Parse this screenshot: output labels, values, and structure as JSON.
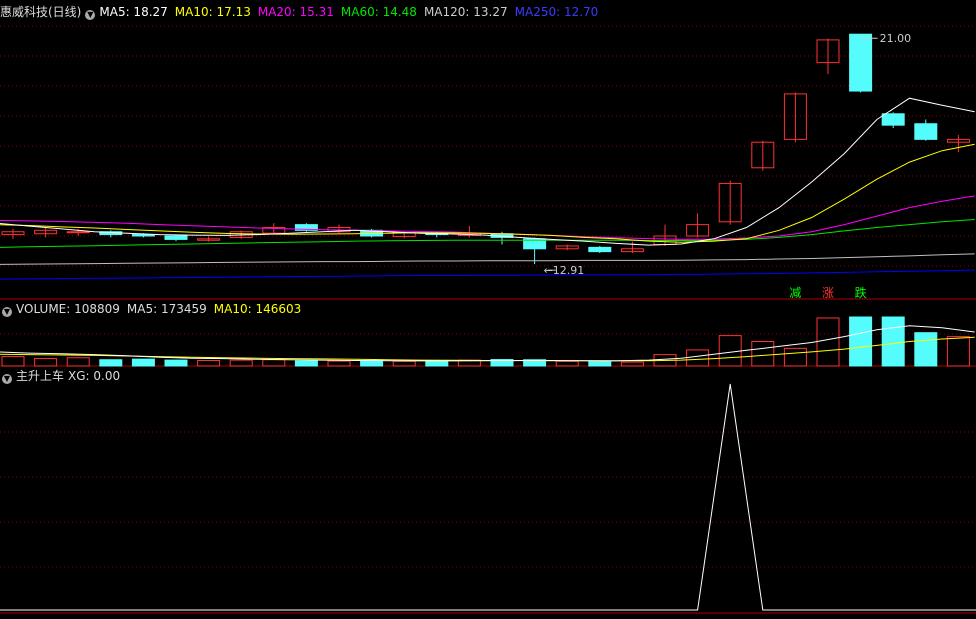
{
  "colors": {
    "up": "#ff3232",
    "down": "#54fcfc",
    "grid": "#8b0000",
    "frame": "#b00000",
    "ma5": "#ffffff",
    "ma10": "#ffff00",
    "ma20": "#ff00ff",
    "ma60": "#00e600",
    "ma120": "#bfbfbf",
    "ma250": "#0000ff",
    "signal": "#ffffff"
  },
  "main_header": {
    "title": "惠威科技(日线)",
    "ma5": "MA5: 18.27",
    "ma10": "MA10: 17.13",
    "ma20": "MA20: 15.31",
    "ma60": "MA60: 14.48",
    "ma120": "MA120: 13.27",
    "ma250": "MA250: 12.70"
  },
  "volume_header": {
    "label": "VOLUME: 108809",
    "ma5": "MA5: 173459",
    "ma10": "MA10: 146603"
  },
  "indicator_header": {
    "label": "主升上车",
    "xg": "XG: 0.00"
  },
  "chart_data": [
    {
      "type": "candlestick",
      "ylim": [
        12.0,
        21.5
      ],
      "high_label": "21.00",
      "low_label": "12.91",
      "candles": [
        {
          "o": 13.95,
          "c": 14.05,
          "h": 14.15,
          "l": 13.8
        },
        {
          "o": 13.98,
          "c": 14.1,
          "h": 14.2,
          "l": 13.85
        },
        {
          "o": 14.05,
          "c": 14.05,
          "h": 14.15,
          "l": 13.9
        },
        {
          "o": 14.05,
          "c": 13.95,
          "h": 14.1,
          "l": 13.85
        },
        {
          "o": 13.95,
          "c": 13.9,
          "h": 14.0,
          "l": 13.85
        },
        {
          "o": 13.9,
          "c": 13.78,
          "h": 13.95,
          "l": 13.72
        },
        {
          "o": 13.75,
          "c": 13.8,
          "h": 13.88,
          "l": 13.7
        },
        {
          "o": 13.85,
          "c": 14.05,
          "h": 14.1,
          "l": 13.8
        },
        {
          "o": 14.0,
          "c": 14.2,
          "h": 14.35,
          "l": 13.95
        },
        {
          "o": 14.3,
          "c": 14.1,
          "h": 14.35,
          "l": 14.05
        },
        {
          "o": 14.05,
          "c": 14.2,
          "h": 14.3,
          "l": 14.0
        },
        {
          "o": 14.1,
          "c": 13.9,
          "h": 14.15,
          "l": 13.85
        },
        {
          "o": 13.88,
          "c": 14.02,
          "h": 14.08,
          "l": 13.82
        },
        {
          "o": 14.0,
          "c": 13.95,
          "h": 14.05,
          "l": 13.85
        },
        {
          "o": 13.92,
          "c": 14.0,
          "h": 14.25,
          "l": 13.85
        },
        {
          "o": 13.98,
          "c": 13.85,
          "h": 14.05,
          "l": 13.6
        },
        {
          "o": 13.8,
          "c": 13.45,
          "h": 13.85,
          "l": 12.91
        },
        {
          "o": 13.45,
          "c": 13.55,
          "h": 13.6,
          "l": 13.4
        },
        {
          "o": 13.5,
          "c": 13.35,
          "h": 13.55,
          "l": 13.3
        },
        {
          "o": 13.35,
          "c": 13.45,
          "h": 13.7,
          "l": 13.3
        },
        {
          "o": 13.6,
          "c": 13.9,
          "h": 14.3,
          "l": 13.55
        },
        {
          "o": 13.9,
          "c": 14.3,
          "h": 14.7,
          "l": 13.85
        },
        {
          "o": 14.4,
          "c": 15.75,
          "h": 15.85,
          "l": 14.3
        },
        {
          "o": 16.3,
          "c": 17.2,
          "h": 17.25,
          "l": 16.2
        },
        {
          "o": 17.3,
          "c": 18.9,
          "h": 18.95,
          "l": 17.2
        },
        {
          "o": 20.0,
          "c": 20.8,
          "h": 20.85,
          "l": 19.6
        },
        {
          "o": 21.0,
          "c": 19.0,
          "h": 21.0,
          "l": 18.95
        },
        {
          "o": 18.2,
          "c": 17.8,
          "h": 18.25,
          "l": 17.7
        },
        {
          "o": 17.85,
          "c": 17.3,
          "h": 18.0,
          "l": 17.25
        },
        {
          "o": 17.2,
          "c": 17.3,
          "h": 17.45,
          "l": 16.85
        }
      ],
      "ma5": [
        14.35,
        14.25,
        14.15,
        14.05,
        14.0,
        13.95,
        13.93,
        13.92,
        13.95,
        14.0,
        14.05,
        14.1,
        14.05,
        14.0,
        13.97,
        13.93,
        13.85,
        13.78,
        13.72,
        13.64,
        13.58,
        13.62,
        13.8,
        14.2,
        14.9,
        15.8,
        16.8,
        18.0,
        18.75,
        18.5,
        18.27
      ],
      "ma10": [
        14.3,
        14.27,
        14.22,
        14.18,
        14.13,
        14.08,
        14.03,
        13.99,
        13.97,
        13.96,
        13.97,
        13.98,
        14.0,
        14.02,
        14.01,
        13.99,
        13.96,
        13.92,
        13.85,
        13.8,
        13.72,
        13.68,
        13.72,
        13.8,
        14.1,
        14.55,
        15.2,
        15.9,
        16.5,
        16.9,
        17.13
      ],
      "ma20": [
        14.45,
        14.43,
        14.41,
        14.38,
        14.35,
        14.3,
        14.26,
        14.22,
        14.18,
        14.15,
        14.12,
        14.1,
        14.08,
        14.06,
        14.04,
        14.0,
        13.96,
        13.92,
        13.88,
        13.84,
        13.81,
        13.78,
        13.79,
        13.83,
        13.9,
        14.05,
        14.3,
        14.6,
        14.9,
        15.12,
        15.31
      ],
      "ma60": [
        13.5,
        13.52,
        13.54,
        13.56,
        13.58,
        13.6,
        13.62,
        13.64,
        13.66,
        13.68,
        13.7,
        13.72,
        13.73,
        13.74,
        13.75,
        13.75,
        13.75,
        13.75,
        13.75,
        13.75,
        13.74,
        13.74,
        13.75,
        13.78,
        13.85,
        13.95,
        14.08,
        14.2,
        14.3,
        14.4,
        14.48
      ],
      "ma120": [
        12.9,
        12.91,
        12.92,
        12.93,
        12.94,
        12.95,
        12.96,
        12.97,
        12.98,
        12.99,
        13.0,
        13.0,
        13.01,
        13.02,
        13.02,
        13.03,
        13.03,
        13.03,
        13.04,
        13.04,
        13.04,
        13.05,
        13.06,
        13.07,
        13.09,
        13.11,
        13.14,
        13.17,
        13.2,
        13.24,
        13.27
      ],
      "ma250": [
        12.38,
        12.39,
        12.4,
        12.41,
        12.42,
        12.43,
        12.44,
        12.45,
        12.46,
        12.47,
        12.48,
        12.49,
        12.5,
        12.51,
        12.51,
        12.52,
        12.52,
        12.53,
        12.53,
        12.54,
        12.54,
        12.55,
        12.56,
        12.57,
        12.58,
        12.6,
        12.62,
        12.64,
        12.66,
        12.68,
        12.7
      ],
      "markers": [
        {
          "index": 24,
          "text": "减",
          "color": "#00ff00"
        },
        {
          "index": 25,
          "text": "涨",
          "color": "#ff3232"
        },
        {
          "index": 26,
          "text": "跌",
          "color": "#00ff00"
        }
      ]
    },
    {
      "type": "bar",
      "ylim": [
        0,
        250000
      ],
      "volume": [
        48000,
        38000,
        42000,
        32000,
        35000,
        30000,
        28000,
        30000,
        32000,
        26000,
        25000,
        27000,
        24000,
        26000,
        30000,
        33000,
        32000,
        24000,
        22000,
        20000,
        58000,
        82000,
        155000,
        125000,
        90000,
        245000,
        250000,
        250000,
        170000,
        150000,
        108809
      ],
      "ma5": [
        72000,
        66000,
        62000,
        58000,
        52000,
        45000,
        40000,
        38000,
        34000,
        32000,
        30000,
        28000,
        27000,
        26000,
        26000,
        27000,
        28000,
        28000,
        27000,
        26000,
        30000,
        40000,
        60000,
        80000,
        100000,
        120000,
        150000,
        185000,
        205000,
        195000,
        173459
      ],
      "ma10": [
        60000,
        58000,
        56000,
        54000,
        51000,
        48000,
        45000,
        42000,
        40000,
        38000,
        36000,
        34000,
        32000,
        30000,
        29000,
        28000,
        27500,
        27000,
        27000,
        26500,
        27000,
        30000,
        38000,
        48000,
        60000,
        72000,
        86000,
        105000,
        125000,
        138000,
        146603
      ]
    },
    {
      "type": "line",
      "ylim": [
        0,
        1
      ],
      "series": [
        {
          "values": [
            0,
            0,
            0,
            0,
            0,
            0,
            0,
            0,
            0,
            0,
            0,
            0,
            0,
            0,
            0,
            0,
            0,
            0,
            0,
            0,
            0,
            0,
            1,
            0,
            0,
            0,
            0,
            0,
            0,
            0
          ]
        }
      ]
    }
  ]
}
